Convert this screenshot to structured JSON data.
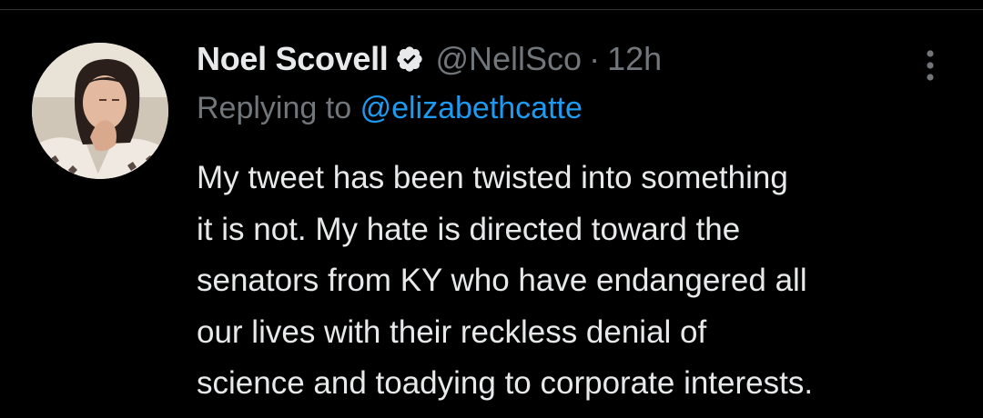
{
  "tweet": {
    "author": {
      "display_name": "Noel Scovell",
      "verified_icon": "verified-badge-icon",
      "handle": "@NellSco",
      "separator": "·",
      "timestamp": "12h",
      "avatar": "profile-photo"
    },
    "reply": {
      "prefix": "Replying to",
      "to_handle": "@elizabethcatte"
    },
    "text": "My tweet has been twisted into something\nit is not. My hate is directed toward the\nsenators from KY who have endangered all\nour lives with their reckless denial of\nscience and toadying to corporate interests.",
    "more_icon": "more-options-vertical-icon"
  },
  "colors": {
    "background": "#000000",
    "primary_text": "#e7e9ea",
    "secondary_text": "#71767b",
    "link": "#1d9bf0",
    "divider": "#2f3336"
  }
}
